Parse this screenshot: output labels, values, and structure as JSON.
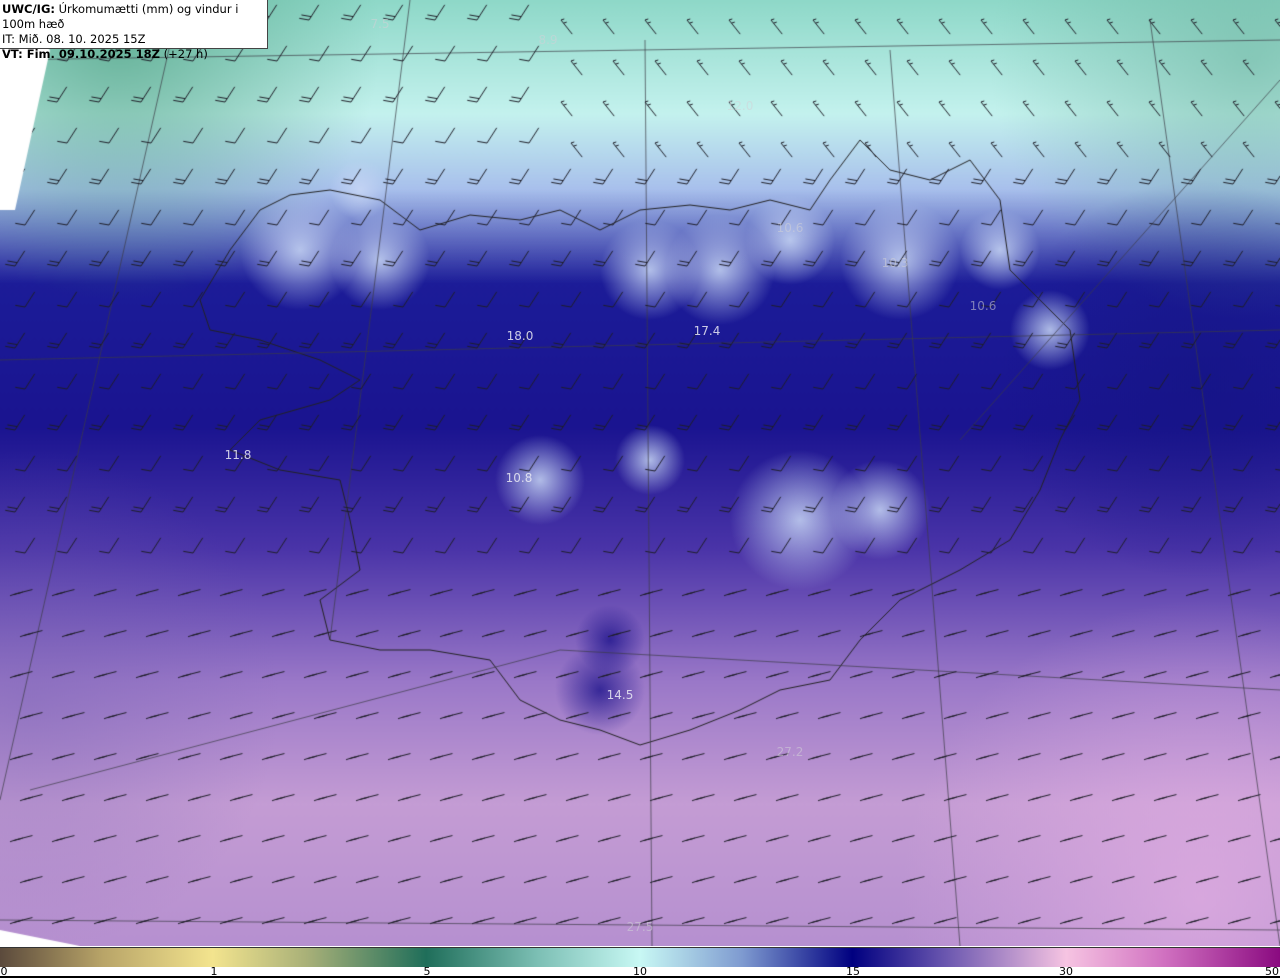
{
  "header": {
    "product": "UWC/IG:",
    "title": "Úrkomumætti (mm) og vindur i 100m hæð",
    "init_time": "IT: Mið. 08. 10. 2025 15Z",
    "valid_label": "VT: Fim. 09.10.2025 18Z",
    "lead_time": "(+27 h)"
  },
  "value_labels": [
    {
      "id": "nw-sea",
      "text": "7.5",
      "faint": true
    },
    {
      "id": "n-sea",
      "text": "8.9",
      "faint": true
    },
    {
      "id": "ne-sea",
      "text": "12.0",
      "faint": true
    },
    {
      "id": "ne-1",
      "text": "10.6",
      "faint": true
    },
    {
      "id": "ne-2",
      "text": "10.3",
      "faint": true
    },
    {
      "id": "ne-3",
      "text": "10.6",
      "faint": true
    },
    {
      "id": "west-fjords-s",
      "text": "18.0",
      "faint": false
    },
    {
      "id": "north-central",
      "text": "17.4",
      "faint": false
    },
    {
      "id": "reykjanes",
      "text": "11.8",
      "faint": false
    },
    {
      "id": "south-highlands",
      "text": "10.8",
      "faint": false
    },
    {
      "id": "south-coast",
      "text": "14.5",
      "faint": false
    },
    {
      "id": "se-sea",
      "text": "27.2",
      "faint": true
    },
    {
      "id": "s-sea",
      "text": "27.5",
      "faint": true
    }
  ],
  "colorbar": {
    "unit": "mm",
    "ticks": [
      "0",
      "1",
      "5",
      "10",
      "15",
      "30",
      "50"
    ],
    "colors": [
      "#5b4a3c",
      "#f3e48e",
      "#1f6e5a",
      "#c8f8f4",
      "#000080",
      "#f6c4e2",
      "#8a0a80"
    ]
  }
}
